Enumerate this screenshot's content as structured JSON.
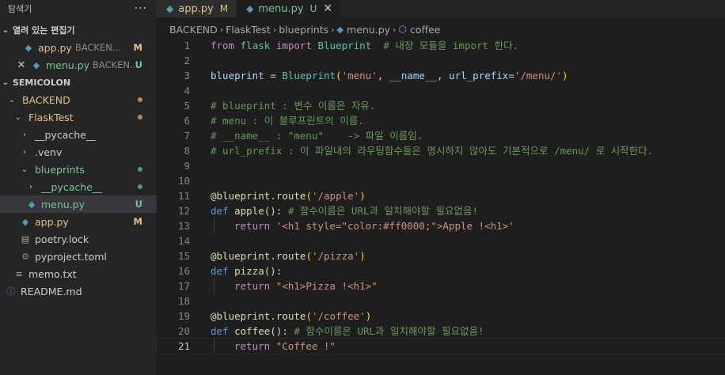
{
  "colors": {
    "modified": "#e2c08d",
    "untracked": "#73c991",
    "folder_dot_modified": "#b38a5a",
    "folder_dot_untracked": "#48a36a"
  },
  "explorer": {
    "title": "탐색기",
    "more": "···",
    "open_editors": {
      "title": "열려 있는 편집기",
      "items": [
        {
          "name": "app.py",
          "desc": "BACKEND...",
          "badge": "M",
          "icon": "python-icon"
        },
        {
          "name": "menu.py",
          "desc": "BACKEN...",
          "badge": "U",
          "icon": "python-icon"
        }
      ]
    },
    "workspace": {
      "title": "SEMICOLON",
      "tree": [
        {
          "name": "BACKEND"
        },
        {
          "name": "FlaskTest"
        },
        {
          "name": "__pycache__"
        },
        {
          "name": ".venv"
        },
        {
          "name": "blueprints"
        },
        {
          "name": "__pycache__"
        },
        {
          "name": "menu.py",
          "badge": "U"
        },
        {
          "name": "app.py",
          "badge": "M"
        },
        {
          "name": "poetry.lock"
        },
        {
          "name": "pyproject.toml"
        },
        {
          "name": "memo.txt"
        },
        {
          "name": "README.md"
        }
      ]
    }
  },
  "tabs": [
    {
      "label": "app.py",
      "badge": "M"
    },
    {
      "label": "menu.py",
      "badge": "U",
      "close": "✕"
    }
  ],
  "breadcrumb": [
    "BACKEND",
    "FlaskTest",
    "blueprints",
    "menu.py",
    "coffee"
  ],
  "code": {
    "line_numbers": [
      "1",
      "2",
      "3",
      "4",
      "5",
      "6",
      "7",
      "8",
      "9",
      "10",
      "11",
      "12",
      "13",
      "14",
      "15",
      "16",
      "17",
      "18",
      "19",
      "20",
      "21"
    ],
    "l1": {
      "a": "from",
      "b": "flask",
      "c": "import",
      "d": "Blueprint",
      "e": "# 내장 모듈을 import 한다."
    },
    "l3": {
      "a": "blueprint",
      "b": " = ",
      "c": "Blueprint",
      "d": "(",
      "e": "'menu'",
      "f": ", ",
      "g": "__name__",
      "h": ", ",
      "i": "url_prefix",
      "j": "=",
      "k": "'/menu/'",
      "l": ")"
    },
    "l5": "# blueprint : 변수 이름은 자유.",
    "l6": "# menu : 이 블루프린트의 이름.",
    "l7": "# __name__ : \"menu\"    -> 파일 이름임.",
    "l8": "# url_prefix : 이 파일내의 라우팅함수들은 명시하지 않아도 기본적으로 /menu/ 로 시작한다.",
    "l11": {
      "a": "@blueprint",
      "b": ".",
      "c": "route",
      "d": "(",
      "e": "'/apple'",
      "f": ")"
    },
    "l12": {
      "a": "def",
      "b": "apple",
      "c": "():",
      "d": " # 함수이름은 URL과 일치해야할 필요없음!"
    },
    "l13": {
      "a": "return",
      "b": "'<h1 style=\"color:#ff0000;\">Apple !<h1>'"
    },
    "l15": {
      "a": "@blueprint",
      "b": ".",
      "c": "route",
      "d": "(",
      "e": "'/pizza'",
      "f": ")"
    },
    "l16": {
      "a": "def",
      "b": "pizza",
      "c": "():"
    },
    "l17": {
      "a": "return",
      "b": "\"<h1>Pizza !<h1>\""
    },
    "l19": {
      "a": "@blueprint",
      "b": ".",
      "c": "route",
      "d": "(",
      "e": "'/coffee'",
      "f": ")"
    },
    "l20": {
      "a": "def",
      "b": "coffee",
      "c": "():",
      "d": " # 함수이름은 URL과 일치해야할 필요없음!"
    },
    "l21": {
      "a": "return",
      "b": "\"Coffee !\""
    }
  }
}
